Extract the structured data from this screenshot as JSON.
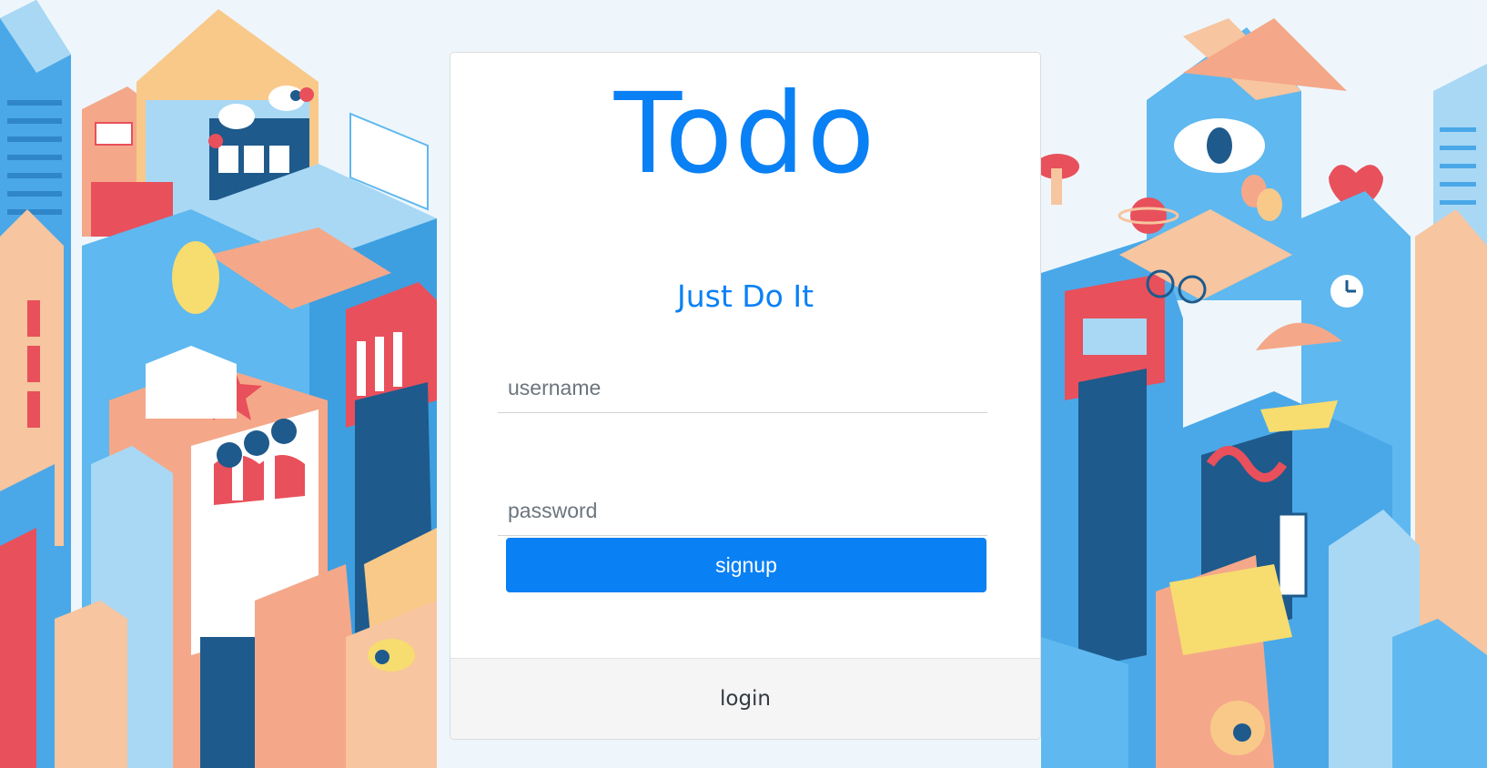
{
  "app": {
    "title": "Todo",
    "tagline": "Just Do It"
  },
  "form": {
    "username_placeholder": "username",
    "username_value": "",
    "password_placeholder": "password",
    "password_value": "",
    "submit_label": "signup"
  },
  "footer": {
    "switch_label": "login"
  },
  "colors": {
    "accent": "#0a80f5",
    "card_background": "#ffffff",
    "footer_background": "#f5f5f5",
    "illustration_blue": "#4aa8e8",
    "illustration_light_blue": "#a9d8f5",
    "illustration_peach": "#f4a889",
    "illustration_red": "#e8505b",
    "illustration_navy": "#1e5a8c",
    "illustration_yellow": "#f7dc6f"
  },
  "background": {
    "illustration": "isometric-city-illustration"
  }
}
